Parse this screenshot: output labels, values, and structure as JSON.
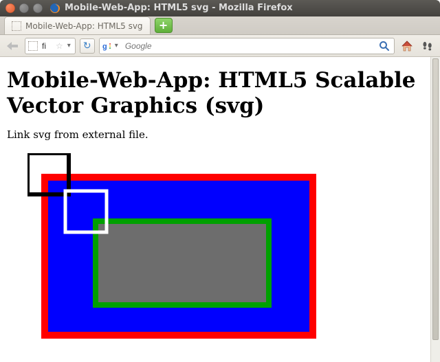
{
  "window": {
    "title": "Mobile-Web-App: HTML5 svg - Mozilla Firefox"
  },
  "tabs": {
    "active_label": "Mobile-Web-App: HTML5 svg"
  },
  "toolbar": {
    "url_value": "fi",
    "search_placeholder": "Google"
  },
  "page": {
    "heading": "Mobile-Web-App: HTML5 Scalable Vector Graphics (svg)",
    "paragraph": "Link svg from external file."
  }
}
